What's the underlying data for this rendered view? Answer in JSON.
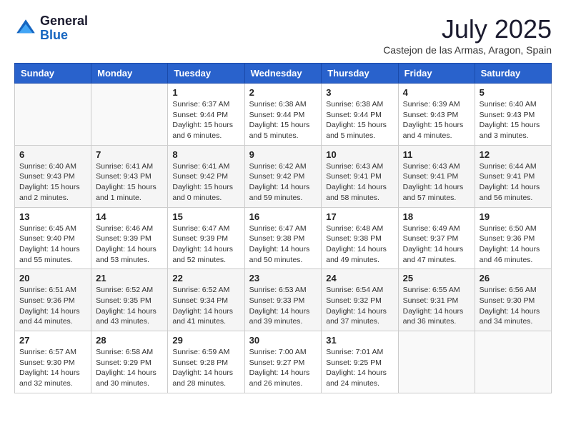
{
  "header": {
    "logo_general": "General",
    "logo_blue": "Blue",
    "month": "July 2025",
    "location": "Castejon de las Armas, Aragon, Spain"
  },
  "weekdays": [
    "Sunday",
    "Monday",
    "Tuesday",
    "Wednesday",
    "Thursday",
    "Friday",
    "Saturday"
  ],
  "weeks": [
    [
      {
        "day": "",
        "info": ""
      },
      {
        "day": "",
        "info": ""
      },
      {
        "day": "1",
        "info": "Sunrise: 6:37 AM\nSunset: 9:44 PM\nDaylight: 15 hours and 6 minutes."
      },
      {
        "day": "2",
        "info": "Sunrise: 6:38 AM\nSunset: 9:44 PM\nDaylight: 15 hours and 5 minutes."
      },
      {
        "day": "3",
        "info": "Sunrise: 6:38 AM\nSunset: 9:44 PM\nDaylight: 15 hours and 5 minutes."
      },
      {
        "day": "4",
        "info": "Sunrise: 6:39 AM\nSunset: 9:43 PM\nDaylight: 15 hours and 4 minutes."
      },
      {
        "day": "5",
        "info": "Sunrise: 6:40 AM\nSunset: 9:43 PM\nDaylight: 15 hours and 3 minutes."
      }
    ],
    [
      {
        "day": "6",
        "info": "Sunrise: 6:40 AM\nSunset: 9:43 PM\nDaylight: 15 hours and 2 minutes."
      },
      {
        "day": "7",
        "info": "Sunrise: 6:41 AM\nSunset: 9:43 PM\nDaylight: 15 hours and 1 minute."
      },
      {
        "day": "8",
        "info": "Sunrise: 6:41 AM\nSunset: 9:42 PM\nDaylight: 15 hours and 0 minutes."
      },
      {
        "day": "9",
        "info": "Sunrise: 6:42 AM\nSunset: 9:42 PM\nDaylight: 14 hours and 59 minutes."
      },
      {
        "day": "10",
        "info": "Sunrise: 6:43 AM\nSunset: 9:41 PM\nDaylight: 14 hours and 58 minutes."
      },
      {
        "day": "11",
        "info": "Sunrise: 6:43 AM\nSunset: 9:41 PM\nDaylight: 14 hours and 57 minutes."
      },
      {
        "day": "12",
        "info": "Sunrise: 6:44 AM\nSunset: 9:41 PM\nDaylight: 14 hours and 56 minutes."
      }
    ],
    [
      {
        "day": "13",
        "info": "Sunrise: 6:45 AM\nSunset: 9:40 PM\nDaylight: 14 hours and 55 minutes."
      },
      {
        "day": "14",
        "info": "Sunrise: 6:46 AM\nSunset: 9:39 PM\nDaylight: 14 hours and 53 minutes."
      },
      {
        "day": "15",
        "info": "Sunrise: 6:47 AM\nSunset: 9:39 PM\nDaylight: 14 hours and 52 minutes."
      },
      {
        "day": "16",
        "info": "Sunrise: 6:47 AM\nSunset: 9:38 PM\nDaylight: 14 hours and 50 minutes."
      },
      {
        "day": "17",
        "info": "Sunrise: 6:48 AM\nSunset: 9:38 PM\nDaylight: 14 hours and 49 minutes."
      },
      {
        "day": "18",
        "info": "Sunrise: 6:49 AM\nSunset: 9:37 PM\nDaylight: 14 hours and 47 minutes."
      },
      {
        "day": "19",
        "info": "Sunrise: 6:50 AM\nSunset: 9:36 PM\nDaylight: 14 hours and 46 minutes."
      }
    ],
    [
      {
        "day": "20",
        "info": "Sunrise: 6:51 AM\nSunset: 9:36 PM\nDaylight: 14 hours and 44 minutes."
      },
      {
        "day": "21",
        "info": "Sunrise: 6:52 AM\nSunset: 9:35 PM\nDaylight: 14 hours and 43 minutes."
      },
      {
        "day": "22",
        "info": "Sunrise: 6:52 AM\nSunset: 9:34 PM\nDaylight: 14 hours and 41 minutes."
      },
      {
        "day": "23",
        "info": "Sunrise: 6:53 AM\nSunset: 9:33 PM\nDaylight: 14 hours and 39 minutes."
      },
      {
        "day": "24",
        "info": "Sunrise: 6:54 AM\nSunset: 9:32 PM\nDaylight: 14 hours and 37 minutes."
      },
      {
        "day": "25",
        "info": "Sunrise: 6:55 AM\nSunset: 9:31 PM\nDaylight: 14 hours and 36 minutes."
      },
      {
        "day": "26",
        "info": "Sunrise: 6:56 AM\nSunset: 9:30 PM\nDaylight: 14 hours and 34 minutes."
      }
    ],
    [
      {
        "day": "27",
        "info": "Sunrise: 6:57 AM\nSunset: 9:30 PM\nDaylight: 14 hours and 32 minutes."
      },
      {
        "day": "28",
        "info": "Sunrise: 6:58 AM\nSunset: 9:29 PM\nDaylight: 14 hours and 30 minutes."
      },
      {
        "day": "29",
        "info": "Sunrise: 6:59 AM\nSunset: 9:28 PM\nDaylight: 14 hours and 28 minutes."
      },
      {
        "day": "30",
        "info": "Sunrise: 7:00 AM\nSunset: 9:27 PM\nDaylight: 14 hours and 26 minutes."
      },
      {
        "day": "31",
        "info": "Sunrise: 7:01 AM\nSunset: 9:25 PM\nDaylight: 14 hours and 24 minutes."
      },
      {
        "day": "",
        "info": ""
      },
      {
        "day": "",
        "info": ""
      }
    ]
  ]
}
